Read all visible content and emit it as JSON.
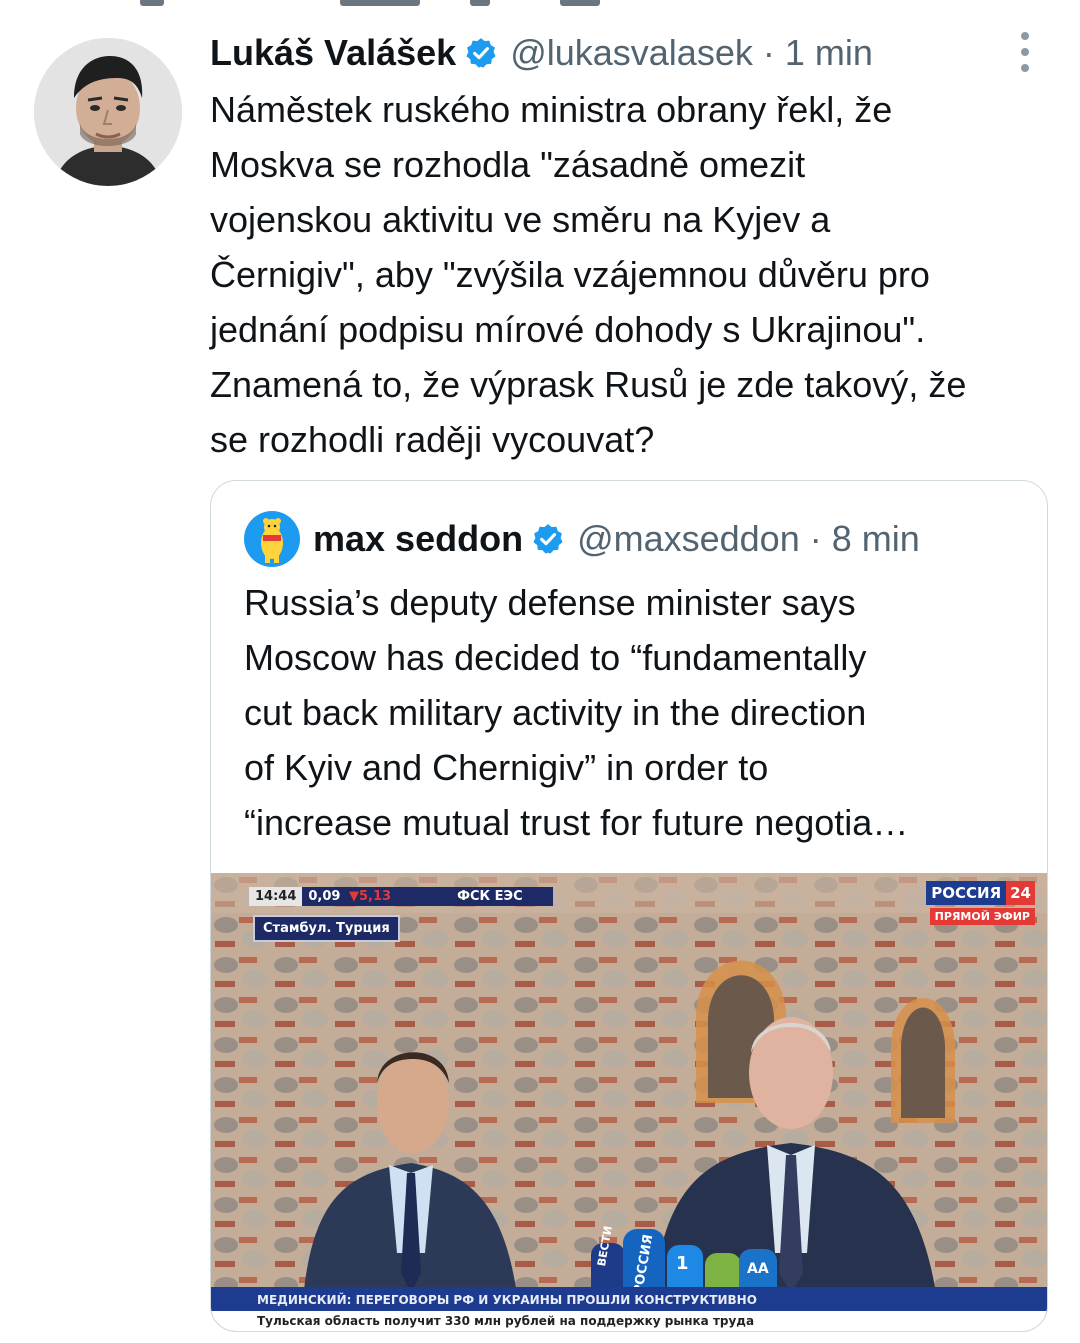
{
  "tweet": {
    "author_name": "Lukáš Valášek",
    "handle": "@lukasvalasek",
    "separator": "·",
    "time": "1 min",
    "text_lines": [
      "Náměstek ruského ministra obrany řekl, že",
      "Moskva se rozhodla \"zásadně omezit",
      "vojenskou aktivitu ve směru na Kyjev a",
      "Černigiv\", aby \"zvýšila vzájemnou důvěru pro",
      "jednání podpisu mírové dohody s Ukrajinou\".",
      "Znamená to, že výprask Rusů je zde takový, že",
      "se rozhodli raději vycouvat?"
    ]
  },
  "quote": {
    "author_name": "max seddon",
    "handle": "@maxseddon",
    "separator": "·",
    "time": "8 min",
    "text_lines": [
      "Russia’s deputy defense minister says",
      "Moscow has decided to “fundamentally",
      "cut back military activity in the direction",
      "of Kyiv and Chernigiv” in order to",
      "“increase mutual trust for future negotia…"
    ],
    "media": {
      "ticker_time": "14:44",
      "ticker_rate": "0,09",
      "ticker_change": "▼5,13",
      "ticker_exchange": "ФСК ЕЭС",
      "location": "Стамбул. Турция",
      "channel_name": "РОССИЯ",
      "channel_number": "24",
      "channel_live": "ПРЯМОЙ ЭФИР",
      "headline": "МЕДИНСКИЙ: ПЕРЕГОВОРЫ РФ И УКРАИНЫ ПРОШЛИ КОНСТРУКТИВНО",
      "subline": "Тульская область получит 330 млн рублей на поддержку рынка труда",
      "mic_labels": [
        "ВЕСТИ",
        "РОССИЯ",
        "1",
        "AA"
      ]
    }
  },
  "colors": {
    "verified": "#1d9bf0",
    "secondary_text": "#536471",
    "channel_blue": "#1d3c8f",
    "channel_red": "#e53935"
  },
  "icons": {
    "verified": "verified-badge-icon",
    "more": "more-options-icon"
  }
}
